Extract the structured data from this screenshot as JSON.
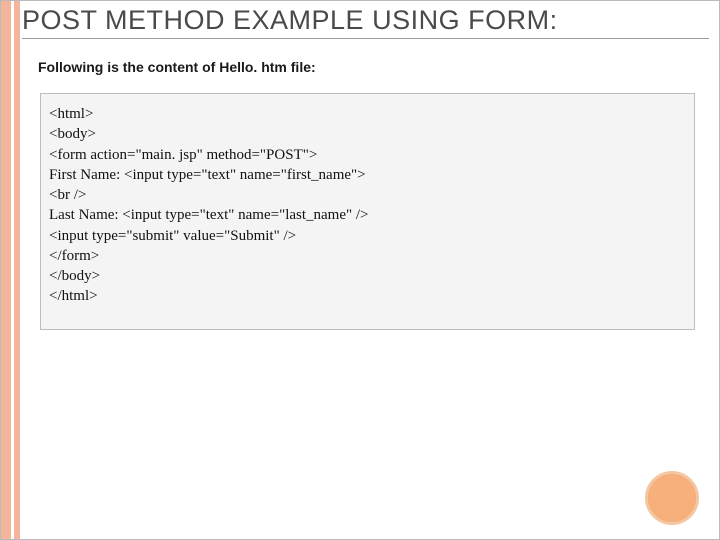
{
  "slide": {
    "title": "POST METHOD EXAMPLE USING FORM:",
    "intro": "Following is the content of Hello. htm file:",
    "lines": [
      "<html>",
      "<body>",
      "<form action=\"main. jsp\" method=\"POST\">",
      "First Name: <input type=\"text\" name=\"first_name\">",
      "<br />",
      "Last Name: <input type=\"text\" name=\"last_name\" />",
      "<input type=\"submit\" value=\"Submit\" />",
      "</form>",
      "</body>",
      "</html>"
    ]
  }
}
